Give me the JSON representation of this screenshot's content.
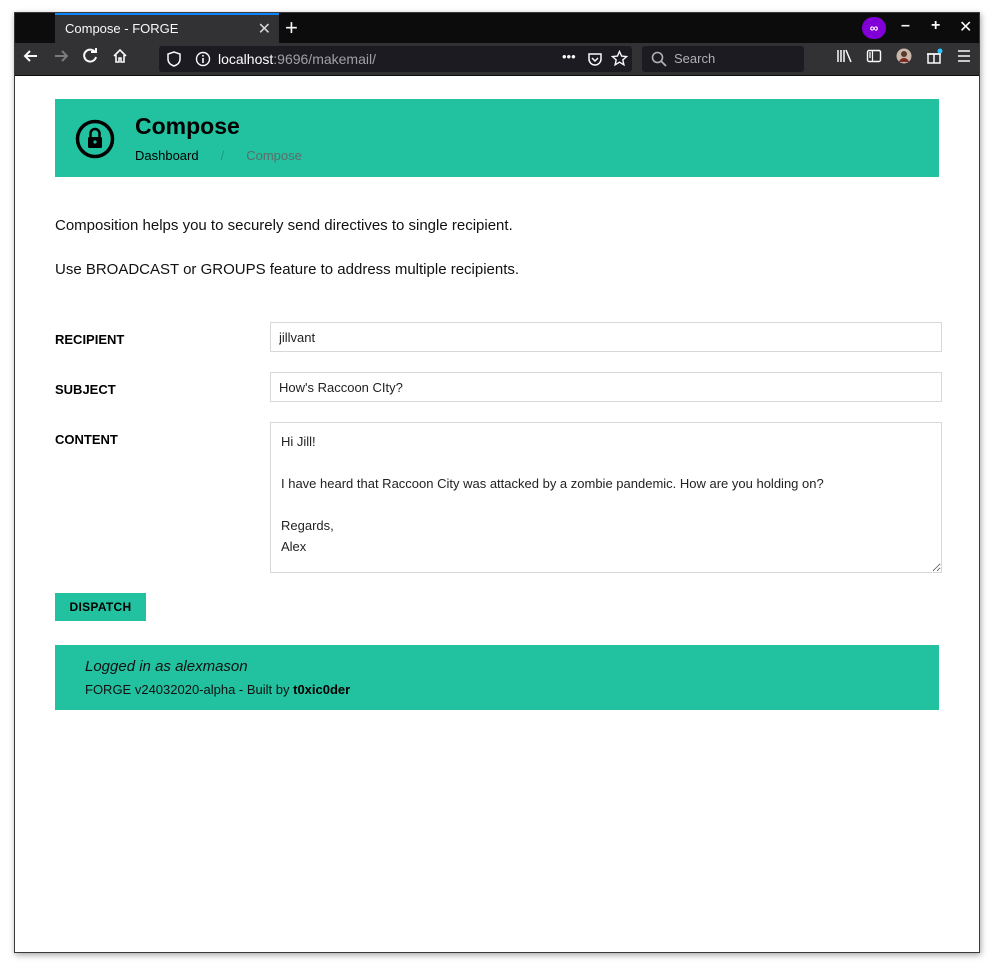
{
  "browser": {
    "tab_title": "Compose - FORGE",
    "tab_close": "✕",
    "new_tab": "+",
    "url_host": "localhost",
    "url_rest": ":9696/makemail/",
    "search_placeholder": "Search",
    "more_glyph": "•••",
    "window_controls": [
      "–",
      "+",
      "✕"
    ]
  },
  "header": {
    "title": "Compose",
    "breadcrumb": {
      "home": "Dashboard",
      "separator": "/",
      "current": "Compose"
    }
  },
  "intro": {
    "line1": "Composition helps you to securely send directives to single recipient.",
    "line2": "Use BROADCAST or GROUPS feature to address multiple recipients."
  },
  "form": {
    "recipient_label": "RECIPIENT",
    "recipient_value": "jillvant",
    "subject_label": "SUBJECT",
    "subject_value": "How's Raccoon CIty?",
    "content_label": "CONTENT",
    "content_value": "Hi Jill!\n\nI have heard that Raccoon City was attacked by a zombie pandemic. How are you holding on?\n\nRegards,\nAlex",
    "dispatch_label": "DISPATCH"
  },
  "footer": {
    "login_text": "Logged in as alexmason",
    "build_text": "FORGE v24032020-alpha - Built by ",
    "author": "t0xic0der"
  },
  "colors": {
    "accent": "#22c1a0",
    "browser_dark": "#0c0c0d",
    "toolbar": "#323234",
    "private": "#8000d7"
  }
}
